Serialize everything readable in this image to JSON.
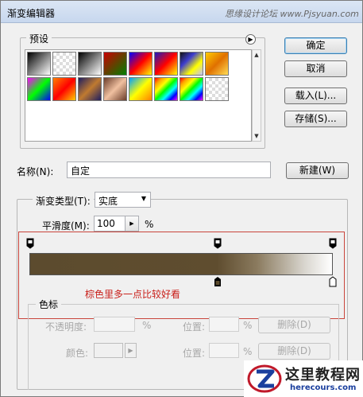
{
  "window": {
    "title": "渐变编辑器",
    "watermark": "思缘设计论坛 www.Pjsyuan.com"
  },
  "presets": {
    "label": "预设",
    "menu_icon": "play-triangle-icon",
    "swatches_row1": [
      "linear-gradient(135deg,#000,#fff)",
      "repeating-conic-gradient(#ddd 0 25%, #fff 0 50%) 0 0/8px 8px",
      "linear-gradient(135deg,#000,#fff)",
      "linear-gradient(135deg,#c80000,#008000)",
      "linear-gradient(135deg,#0000ff,#ff0000,#ffff00)",
      "linear-gradient(135deg,#1b1bbf,#ff0000,#ffff00)",
      "linear-gradient(135deg,#111,#3d3dcf,#ffff00,#c0c0ff)",
      "linear-gradient(135deg,#ffcc00,#e07000,#ffdd55)"
    ],
    "swatches_row2": [
      "linear-gradient(135deg,#ff00ff,#00ff00,#0000ff)",
      "linear-gradient(135deg,#ff8000,#ff0000,#ffcc00)",
      "linear-gradient(135deg,#1e1e60,#c07a30,#1e1e60)",
      "linear-gradient(135deg,#6b3d2a,#f0c0a0,#6b3d2a)",
      "linear-gradient(135deg,#00a0ff,#ffff00,#ff8000)",
      "linear-gradient(135deg,red,orange,yellow,lime,cyan,blue,magenta)",
      "linear-gradient(135deg,red,orange,yellow,lime,cyan,blue,magenta)",
      "repeating-conic-gradient(#ddd 0 25%, #fff 0 50%) 0 0/8px 8px"
    ]
  },
  "buttons": {
    "ok": "确定",
    "cancel": "取消",
    "load": "载入(L)...",
    "save": "存储(S)...",
    "new": "新建(W)"
  },
  "name": {
    "label": "名称(N):",
    "value": "自定"
  },
  "gradient": {
    "type_label": "渐变类型(T):",
    "type_value": "实底",
    "smoothness_label": "平滑度(M):",
    "smoothness_value": "100",
    "smoothness_unit": "%",
    "annotation": "棕色里多一点比较好看"
  },
  "stops": {
    "group_label": "色标",
    "opacity_label": "不透明度:",
    "opacity_unit": "%",
    "location_label": "位置:",
    "location_unit": "%",
    "delete_label": "删除(D)",
    "color_label": "颜色:",
    "location_label2": "位置:",
    "location_unit2": "%",
    "delete_label2": "删除(D)"
  },
  "logo": {
    "main": "这里教程网",
    "sub": "herecours.com"
  },
  "colors": {
    "brown": "#5c4b2e",
    "annotation_red": "#c9201a"
  }
}
